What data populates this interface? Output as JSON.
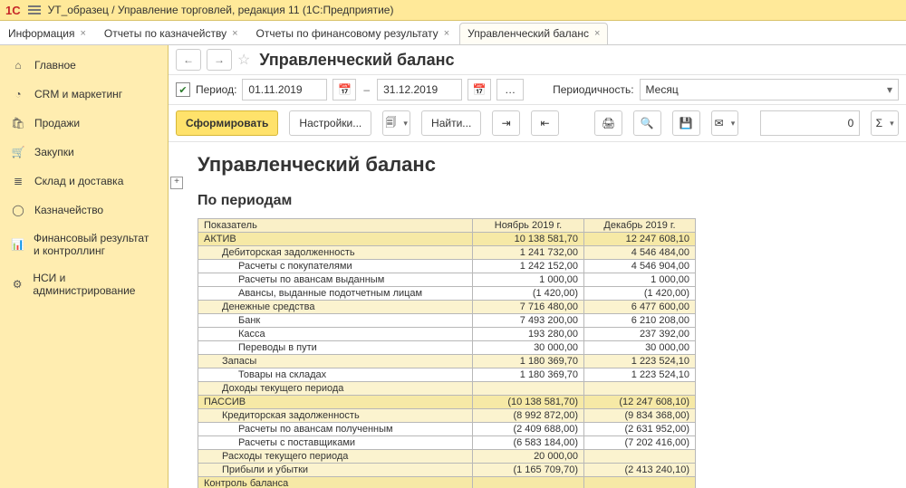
{
  "window_title": "УТ_образец / Управление торговлей, редакция 11  (1С:Предприятие)",
  "tabs": [
    {
      "label": "Информация",
      "active": false
    },
    {
      "label": "Отчеты по казначейству",
      "active": false
    },
    {
      "label": "Отчеты по финансовому результату",
      "active": false
    },
    {
      "label": "Управленческий баланс",
      "active": true
    }
  ],
  "sidebar": {
    "items": [
      {
        "icon": "home",
        "label": "Главное"
      },
      {
        "icon": "crm",
        "label": "CRM и маркетинг"
      },
      {
        "icon": "sales",
        "label": "Продажи"
      },
      {
        "icon": "purch",
        "label": "Закупки"
      },
      {
        "icon": "stock",
        "label": "Склад и доставка"
      },
      {
        "icon": "treasury",
        "label": "Казначейство"
      },
      {
        "icon": "fin",
        "label": "Финансовый результат и контроллинг"
      },
      {
        "icon": "admin",
        "label": "НСИ и администрирование"
      }
    ]
  },
  "page": {
    "title": "Управленческий баланс",
    "period_label": "Период:",
    "date_from": "01.11.2019",
    "date_to": "31.12.2019",
    "period_checked": true,
    "freq_label": "Периодичность:",
    "freq_value": "Месяц"
  },
  "toolbar": {
    "form": "Сформировать",
    "settings": "Настройки...",
    "find": "Найти...",
    "zero": "0"
  },
  "report": {
    "title": "Управленческий баланс",
    "subtitle": "По периодам",
    "col_indicator": "Показатель",
    "col1": "Ноябрь 2019 г.",
    "col2": "Декабрь 2019 г.",
    "rows": [
      {
        "lvl": 0,
        "label": "АКТИВ",
        "v1": "10 138 581,70",
        "v2": "12 247 608,10"
      },
      {
        "lvl": 1,
        "label": "Дебиторская задолженность",
        "v1": "1 241 732,00",
        "v2": "4 546 484,00"
      },
      {
        "lvl": 2,
        "label": "Расчеты с покупателями",
        "v1": "1 242 152,00",
        "v2": "4 546 904,00"
      },
      {
        "lvl": 2,
        "label": "Расчеты по авансам выданным",
        "v1": "1 000,00",
        "v2": "1 000,00"
      },
      {
        "lvl": 2,
        "label": "Авансы, выданные подотчетным лицам",
        "v1": "(1 420,00)",
        "v2": "(1 420,00)"
      },
      {
        "lvl": 1,
        "label": "Денежные средства",
        "v1": "7 716 480,00",
        "v2": "6 477 600,00"
      },
      {
        "lvl": 2,
        "label": "Банк",
        "v1": "7 493 200,00",
        "v2": "6 210 208,00"
      },
      {
        "lvl": 2,
        "label": "Касса",
        "v1": "193 280,00",
        "v2": "237 392,00"
      },
      {
        "lvl": 2,
        "label": "Переводы в пути",
        "v1": "30 000,00",
        "v2": "30 000,00"
      },
      {
        "lvl": 1,
        "label": "Запасы",
        "v1": "1 180 369,70",
        "v2": "1 223 524,10"
      },
      {
        "lvl": 2,
        "label": "Товары на складах",
        "v1": "1 180 369,70",
        "v2": "1 223 524,10"
      },
      {
        "lvl": 1,
        "label": "Доходы текущего периода",
        "v1": "",
        "v2": ""
      },
      {
        "lvl": 0,
        "label": "ПАССИВ",
        "v1": "(10 138 581,70)",
        "v2": "(12 247 608,10)"
      },
      {
        "lvl": 1,
        "label": "Кредиторская задолженность",
        "v1": "(8 992 872,00)",
        "v2": "(9 834 368,00)"
      },
      {
        "lvl": 2,
        "label": "Расчеты по авансам полученным",
        "v1": "(2 409 688,00)",
        "v2": "(2 631 952,00)"
      },
      {
        "lvl": 2,
        "label": "Расчеты с поставщиками",
        "v1": "(6 583 184,00)",
        "v2": "(7 202 416,00)"
      },
      {
        "lvl": 1,
        "label": "Расходы текущего периода",
        "v1": "20 000,00",
        "v2": ""
      },
      {
        "lvl": 1,
        "label": "Прибыли и убытки",
        "v1": "(1 165 709,70)",
        "v2": "(2 413 240,10)"
      },
      {
        "lvl": 0,
        "label": "Контроль баланса",
        "v1": "",
        "v2": "",
        "ctrl": true
      }
    ]
  },
  "chart_data": {
    "type": "table",
    "title": "Управленческий баланс — По периодам",
    "categories": [
      "Ноябрь 2019 г.",
      "Декабрь 2019 г."
    ],
    "series": [
      {
        "name": "АКТИВ",
        "values": [
          10138581.7,
          12247608.1
        ]
      },
      {
        "name": "Дебиторская задолженность",
        "values": [
          1241732.0,
          4546484.0
        ]
      },
      {
        "name": "Расчеты с покупателями",
        "values": [
          1242152.0,
          4546904.0
        ]
      },
      {
        "name": "Расчеты по авансам выданным",
        "values": [
          1000.0,
          1000.0
        ]
      },
      {
        "name": "Авансы, выданные подотчетным лицам",
        "values": [
          -1420.0,
          -1420.0
        ]
      },
      {
        "name": "Денежные средства",
        "values": [
          7716480.0,
          6477600.0
        ]
      },
      {
        "name": "Банк",
        "values": [
          7493200.0,
          6210208.0
        ]
      },
      {
        "name": "Касса",
        "values": [
          193280.0,
          237392.0
        ]
      },
      {
        "name": "Переводы в пути",
        "values": [
          30000.0,
          30000.0
        ]
      },
      {
        "name": "Запасы",
        "values": [
          1180369.7,
          1223524.1
        ]
      },
      {
        "name": "Товары на складах",
        "values": [
          1180369.7,
          1223524.1
        ]
      },
      {
        "name": "Доходы текущего периода",
        "values": [
          null,
          null
        ]
      },
      {
        "name": "ПАССИВ",
        "values": [
          -10138581.7,
          -12247608.1
        ]
      },
      {
        "name": "Кредиторская задолженность",
        "values": [
          -8992872.0,
          -9834368.0
        ]
      },
      {
        "name": "Расчеты по авансам полученным",
        "values": [
          -2409688.0,
          -2631952.0
        ]
      },
      {
        "name": "Расчеты с поставщиками",
        "values": [
          -6583184.0,
          -7202416.0
        ]
      },
      {
        "name": "Расходы текущего периода",
        "values": [
          20000.0,
          null
        ]
      },
      {
        "name": "Прибыли и убытки",
        "values": [
          -1165709.7,
          -2413240.1
        ]
      },
      {
        "name": "Контроль баланса",
        "values": [
          null,
          null
        ]
      }
    ]
  }
}
